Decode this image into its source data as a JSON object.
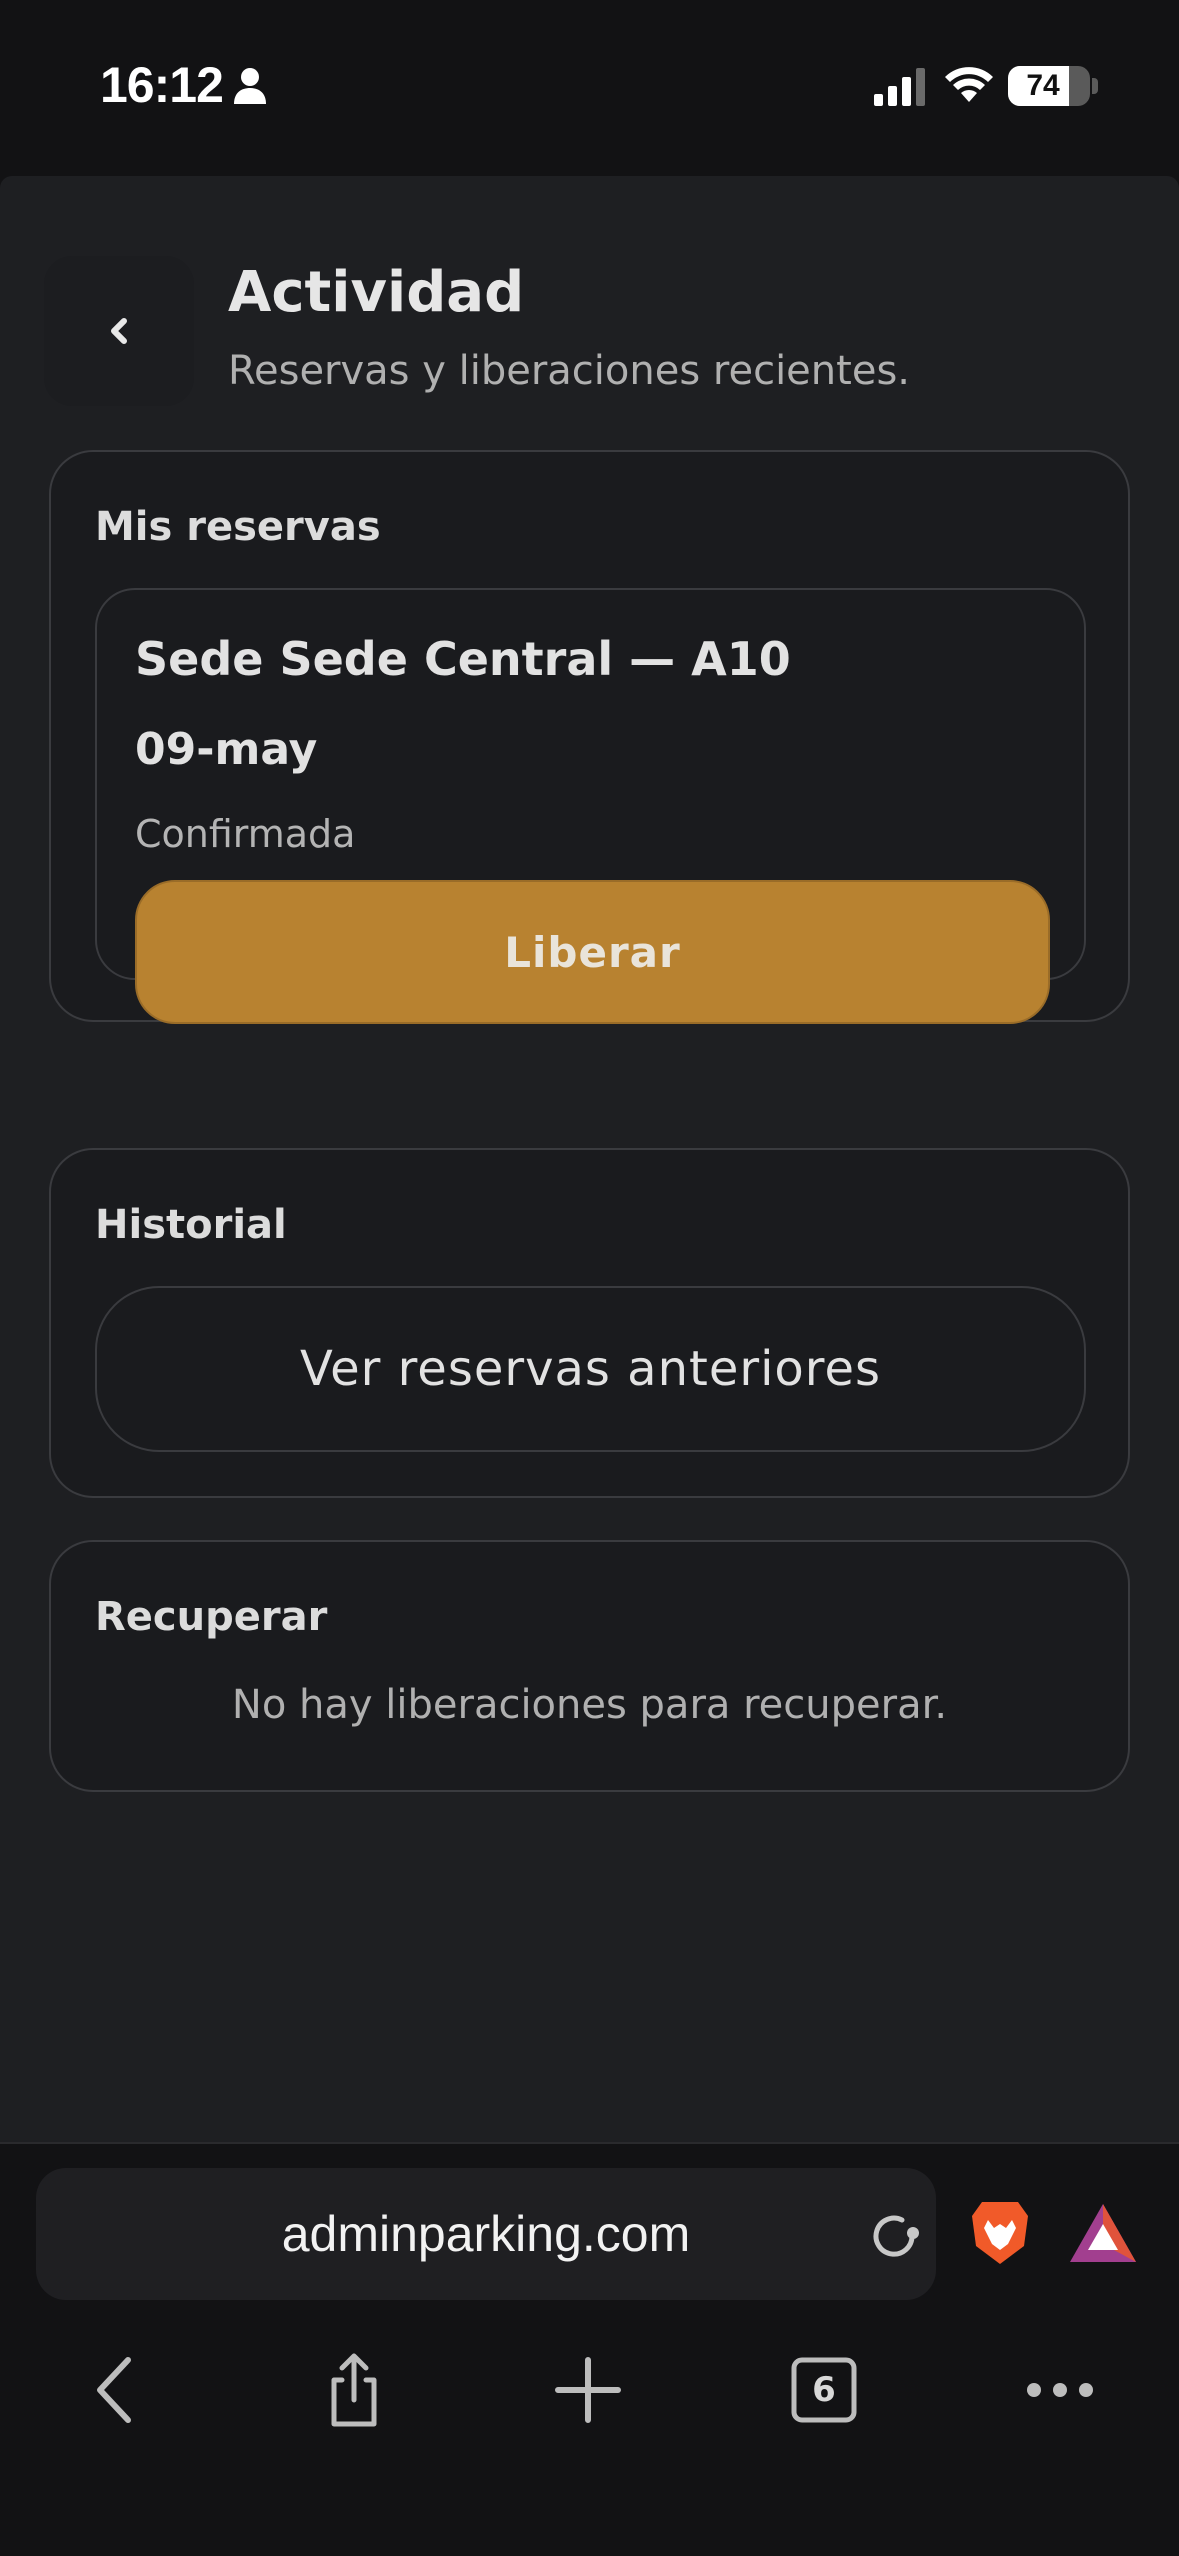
{
  "status_bar": {
    "time": "16:12",
    "battery_percent": "74",
    "battery_level": 0.74,
    "icons": [
      "person-icon",
      "signal-icon",
      "wifi-icon",
      "battery-icon"
    ]
  },
  "header": {
    "title": "Actividad",
    "subtitle": "Reservas y liberaciones recientes.",
    "back_icon": "chevron-left-icon"
  },
  "mis_reservas": {
    "title": "Mis reservas",
    "items": [
      {
        "title": "Sede Sede Central — A10",
        "date": "09-may",
        "status": "Confirmada",
        "action_label": "Liberar"
      }
    ]
  },
  "historial": {
    "title": "Historial",
    "button_label": "Ver reservas anteriores"
  },
  "recuperar": {
    "title": "Recuperar",
    "empty_message": "No hay liberaciones para recuperar."
  },
  "browser": {
    "url": "adminparking.com",
    "tabs_count": "6",
    "icons": [
      "reload-icon",
      "brave-lion-icon",
      "bat-rewards-icon",
      "back-arrow-icon",
      "share-icon",
      "plus-icon",
      "tabs-icon",
      "more-icon"
    ]
  },
  "colors": {
    "accent": "#b88230",
    "page_bg": "#1e1f22",
    "card_bg": "#1a1b1e",
    "border": "#3a3b3f"
  }
}
